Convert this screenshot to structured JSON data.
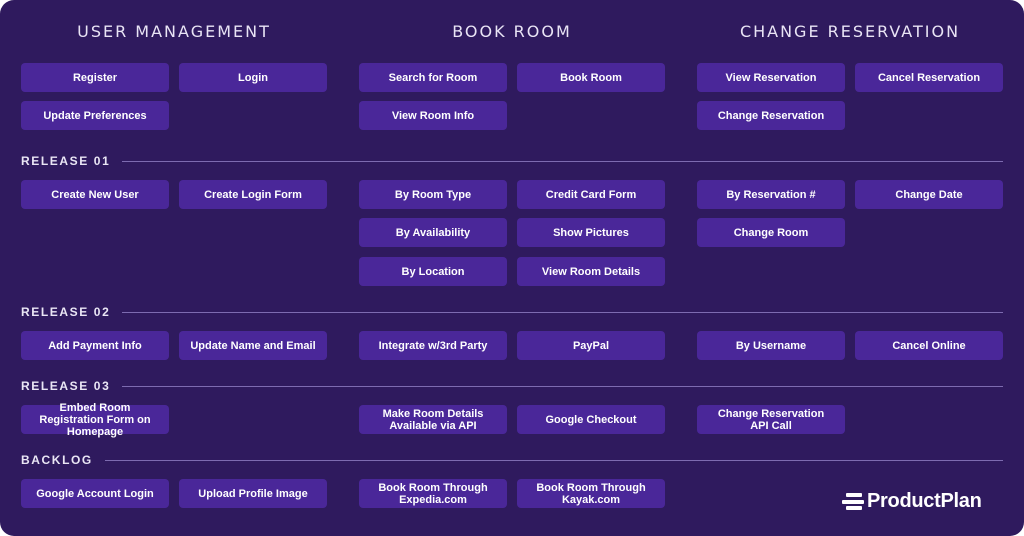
{
  "columns": [
    {
      "title": "USER MANAGEMENT"
    },
    {
      "title": "BOOK ROOM"
    },
    {
      "title": "CHANGE RESERVATION"
    }
  ],
  "backbone": {
    "user_management": [
      "Register",
      "Login",
      "Update Preferences"
    ],
    "book_room": [
      "Search for Room",
      "Book Room",
      "View Room Info"
    ],
    "change_reservation": [
      "View Reservation",
      "Cancel Reservation",
      "Change Reservation"
    ]
  },
  "releases": [
    {
      "label": "RELEASE 01",
      "user_management": [
        "Create New User",
        "Create Login Form"
      ],
      "book_room": [
        "By Room Type",
        "Credit Card Form",
        "By Availability",
        "Show Pictures",
        "By Location",
        "View Room Details"
      ],
      "change_reservation": [
        "By Reservation #",
        "Change Date",
        "Change Room"
      ]
    },
    {
      "label": "RELEASE 02",
      "user_management": [
        "Add Payment Info",
        "Update Name and Email"
      ],
      "book_room": [
        "Integrate w/3rd Party",
        "PayPal"
      ],
      "change_reservation": [
        "By Username",
        "Cancel Online"
      ]
    },
    {
      "label": "RELEASE 03",
      "user_management": [
        "Embed Room Registration Form on Homepage"
      ],
      "book_room": [
        "Make Room Details Available via API",
        "Google Checkout"
      ],
      "change_reservation": [
        "Change Reservation API Call"
      ]
    },
    {
      "label": "BACKLOG",
      "user_management": [
        "Google Account Login",
        "Upload Profile Image"
      ],
      "book_room": [
        "Book Room Through Expedia.com",
        "Book Room Through Kayak.com"
      ],
      "change_reservation": []
    }
  ],
  "logo": {
    "text": "ProductPlan",
    "icon": "productplan-logo-icon"
  },
  "colors": {
    "background": "#2f1a5e",
    "card": "#4a2799",
    "divider": "#7d6bb0",
    "text": "#ffffff"
  }
}
